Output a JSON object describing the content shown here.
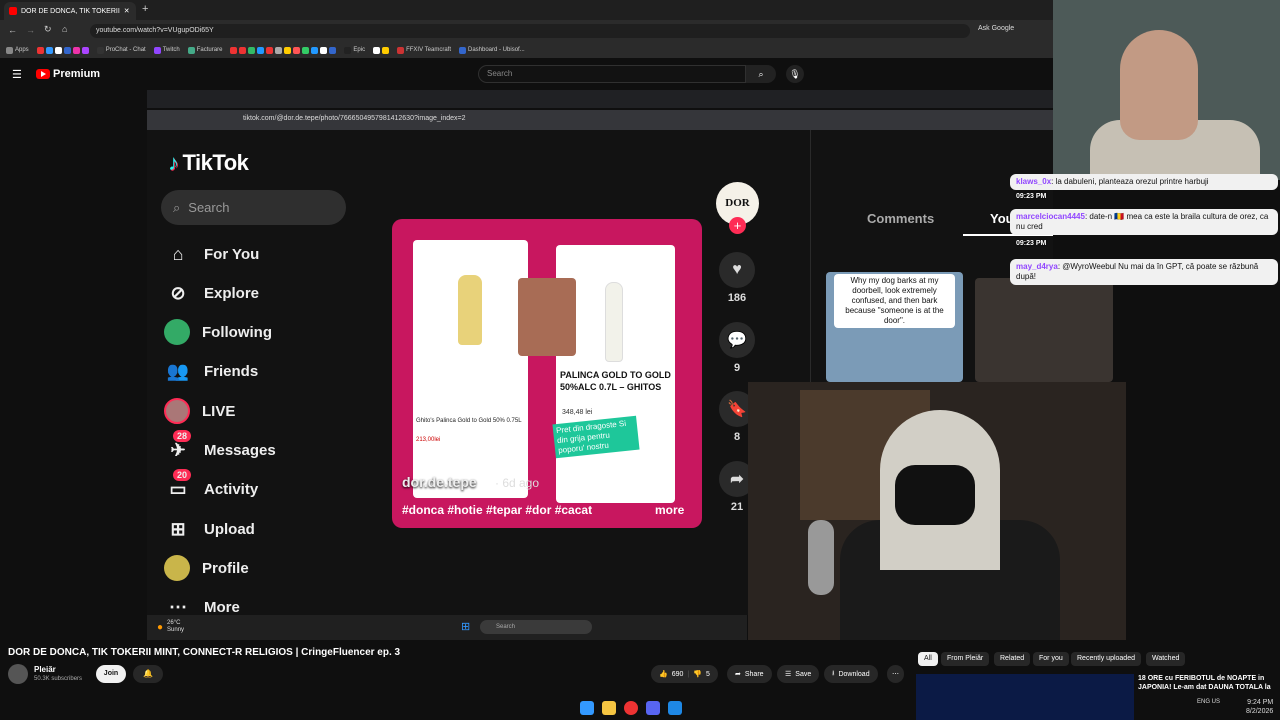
{
  "chrome": {
    "tab_title": "DOR DE DONCA, TIK TOKERII",
    "url": "youtube.com/watch?v=VUgupODi65Y",
    "ask_google": "Ask Google",
    "bookmarks": [
      "Apps",
      "ProChat - Chat",
      "Twitch",
      "Facturare",
      "Epic",
      "FFXIV Teamcraft",
      "Dashboard - Ubisof..."
    ]
  },
  "youtube": {
    "logo": "Premium",
    "search_placeholder": "Search",
    "video_title": "DOR DE DONCA, TIK TOKERII MINT, CONNECT-R RELIGIOS | CringeFluencer ep. 3",
    "channel_name": "Pleiăr",
    "channel_subs": "50.3K subscribers",
    "join": "Join",
    "likes": "690",
    "dislikes": "5",
    "share": "Share",
    "save": "Save",
    "download": "Download",
    "chips": [
      "All",
      "From Pleiăr",
      "Related",
      "For you",
      "Recently uploaded",
      "Watched"
    ],
    "rec_title": "18 ORE cu FERIBOTUL de NOAPTE in JAPONIA! Le-am dat DAUNA TOTALA la"
  },
  "inner_browser": {
    "url": "tiktok.com/@dor.de.tepe/photo/7666504957981412630?image_index=2"
  },
  "tiktok": {
    "logo": "TikTok",
    "search_placeholder": "Search",
    "nav": [
      {
        "label": "For You",
        "icon": "home-icon",
        "badge": ""
      },
      {
        "label": "Explore",
        "icon": "compass-icon",
        "badge": ""
      },
      {
        "label": "Following",
        "icon": "following-icon",
        "badge": ""
      },
      {
        "label": "Friends",
        "icon": "friends-icon",
        "badge": ""
      },
      {
        "label": "LIVE",
        "icon": "live-icon",
        "badge": ""
      },
      {
        "label": "Messages",
        "icon": "messages-icon",
        "badge": "28"
      },
      {
        "label": "Activity",
        "icon": "activity-icon",
        "badge": "20"
      },
      {
        "label": "Upload",
        "icon": "upload-icon",
        "badge": ""
      },
      {
        "label": "Profile",
        "icon": "profile-icon",
        "badge": ""
      },
      {
        "label": "More",
        "icon": "more-icon",
        "badge": ""
      }
    ],
    "post": {
      "author": "dor.de.tepe",
      "date": "· 6d ago",
      "tags": "#donca #hotie #tepar #dor #cacat",
      "more": "more",
      "product_name": "PALINCA GOLD TO GOLD 50%ALC 0.7L – GHITOS",
      "product_price": "348,48 lei",
      "promo": "Pret din dragoste Si din grija pentru poporu' nostru",
      "left_product": "Ghito's Palinca Gold to Gold 50% 0.75L",
      "left_price": "213,00lei"
    },
    "avatar_text": "DOR",
    "actions": {
      "likes": "186",
      "comments": "9",
      "saves": "8",
      "shares": "21"
    },
    "comments_tab": "Comments",
    "you_tab": "You",
    "thumb_caption": "Why my dog barks at my doorbell, look extremely confused, and then bark because \"someone is at the door\"."
  },
  "chat": [
    {
      "user": "klaws_0x",
      "msg": ": la dabuleni, planteaza orezul printre harbuji",
      "time": "09:23 PM"
    },
    {
      "user": "marcelciocan4445",
      "msg": ": date-n 🇷🇴 mea ca este la braila cultura de orez, ca nu cred",
      "time": "09:23 PM"
    },
    {
      "user": "may_d4rya",
      "msg": ": @WyroWeebul Nu mai da în GPT, că poate se răzbună după!",
      "time": ""
    }
  ],
  "windows": {
    "temp": "26°C",
    "weather": "Sunny",
    "search": "Search",
    "lang": "ENG US",
    "time": "9:24 PM",
    "date": "8/2/2026"
  }
}
